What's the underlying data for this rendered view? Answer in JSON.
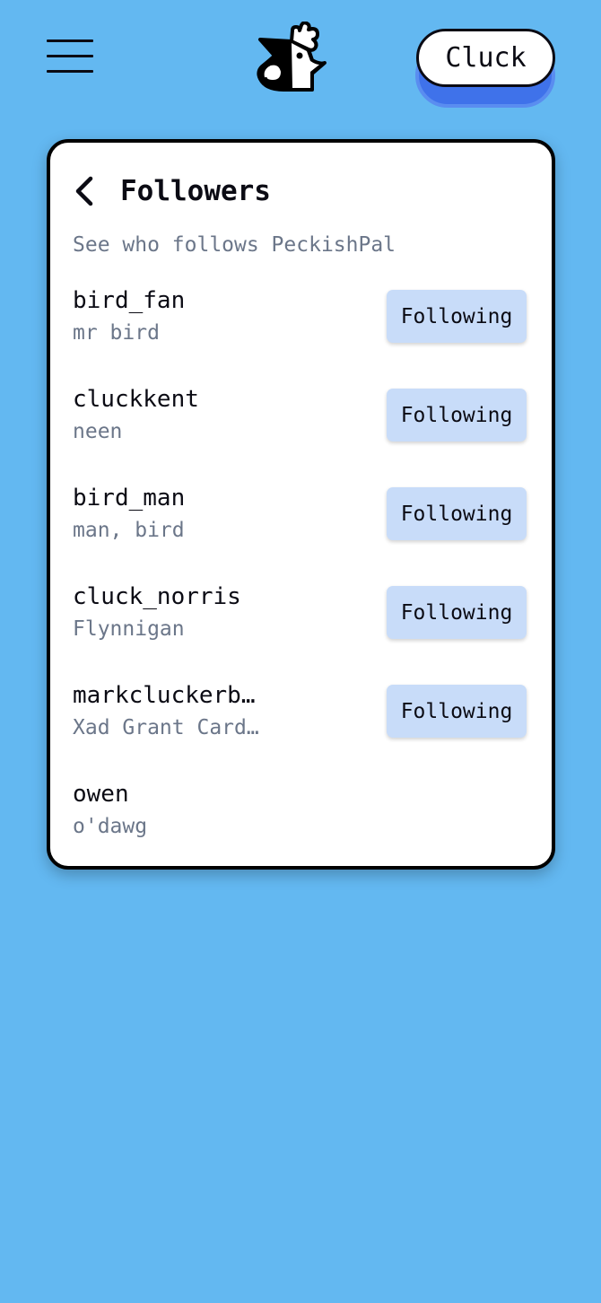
{
  "header": {
    "menu_icon": "hamburger-menu-icon",
    "logo_icon": "chicken-logo-icon",
    "cluck_label": "Cluck"
  },
  "card": {
    "back_icon": "chevron-left-icon",
    "title": "Followers",
    "subtitle": "See who follows PeckishPal",
    "followers": [
      {
        "username": "bird_fan",
        "display_name": "mr bird",
        "button": "Following"
      },
      {
        "username": "cluckkent",
        "display_name": "neen",
        "button": "Following"
      },
      {
        "username": "bird_man",
        "display_name": "man, bird",
        "button": "Following"
      },
      {
        "username": "cluck_norris",
        "display_name": "Flynnigan",
        "button": "Following"
      },
      {
        "username": "markcluckerb…",
        "display_name": "Xad Grant Card…",
        "button": "Following"
      },
      {
        "username": "owen",
        "display_name": "o'dawg",
        "button": ""
      }
    ]
  },
  "colors": {
    "background": "#63b8f1",
    "accent": "#3f72ea",
    "follow_button": "#c8dcf9",
    "muted_text": "#6b7689"
  }
}
